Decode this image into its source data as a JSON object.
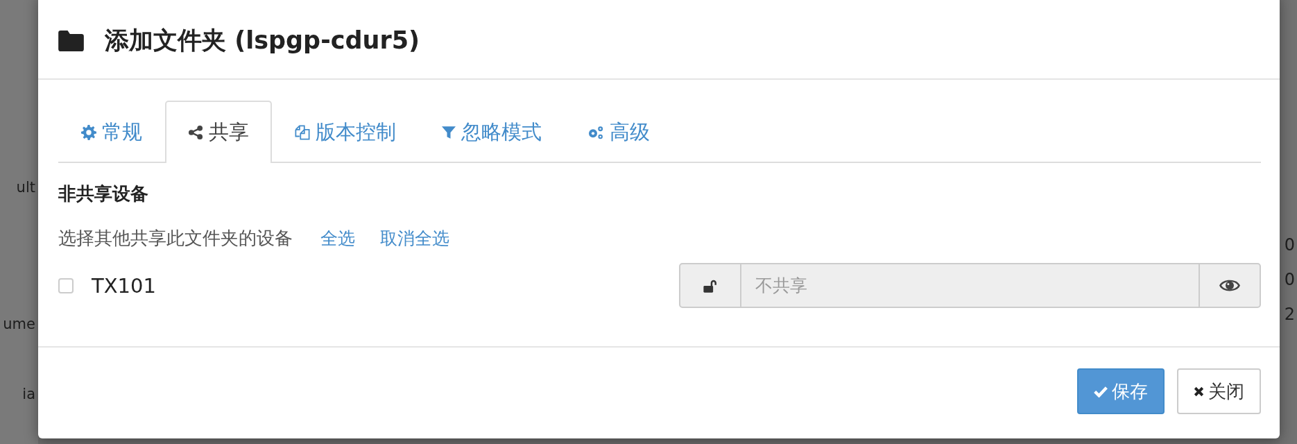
{
  "background": {
    "left_fragments": [
      "ult",
      "ume",
      "ia"
    ],
    "right_fragments": [
      "0",
      "0",
      "2"
    ]
  },
  "dialog": {
    "title": "添加文件夹 (lspgp-cdur5)",
    "tabs": [
      {
        "label": "常规",
        "selected": false
      },
      {
        "label": "共享",
        "selected": true
      },
      {
        "label": "版本控制",
        "selected": false
      },
      {
        "label": "忽略模式",
        "selected": false
      },
      {
        "label": "高级",
        "selected": false
      }
    ],
    "section_heading": "非共享设备",
    "description": "选择其他共享此文件夹的设备",
    "links": [
      "全选",
      "取消全选"
    ],
    "devices": [
      {
        "name": "TX101",
        "checked": false,
        "share_field": {
          "placeholder": "不共享",
          "disabled": true
        }
      }
    ],
    "buttons": [
      {
        "kind": "primary",
        "label": "保存"
      },
      {
        "kind": "default",
        "label": "关闭"
      }
    ]
  }
}
